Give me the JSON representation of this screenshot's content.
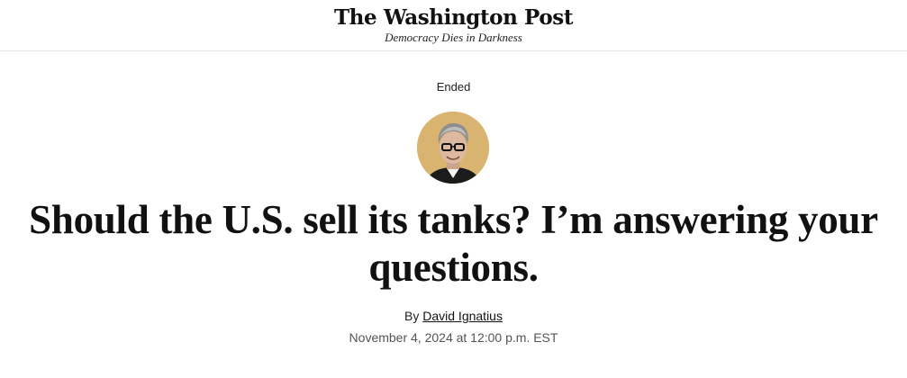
{
  "masthead": {
    "logo_text": "The Washington Post",
    "tagline": "Democracy Dies in Darkness"
  },
  "article": {
    "status": "Ended",
    "headline": "Should the U.S. sell its tanks? I’m answering your questions.",
    "byline_prefix": "By",
    "author": "David Ignatius",
    "date": "November 4, 2024 at 12:00 p.m. EST"
  },
  "colors": {
    "avatar_background": "#d9b370",
    "divider": "#e5e5e5"
  },
  "icons": {
    "author_avatar": "author-photo"
  }
}
